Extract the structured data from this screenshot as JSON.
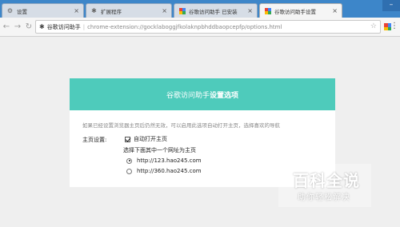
{
  "browser": {
    "tabs": [
      {
        "label": "设置",
        "icon": "gear-icon"
      },
      {
        "label": "扩展程序",
        "icon": "puzzle-icon"
      },
      {
        "label": "谷歌访问助手 已安装",
        "icon": "extension-color-icon"
      },
      {
        "label": "谷歌访问助手设置",
        "icon": "extension-color-icon",
        "active": true
      }
    ],
    "omnibox": {
      "origin": "谷歌访问助手",
      "url": "chrome-extension://gocklaboggjfkolaknpbhddbaopcepfp/options.html"
    }
  },
  "page": {
    "header_prefix": "谷歌访问助手",
    "header_bold": "设置选项",
    "intro": "如果已经设置浏览器主页后仍然无效，可以启用此选项自动打开主页，选择喜欢的导航",
    "homepage_label": "主页设置:",
    "auto_open_label": "自动打开主页",
    "choose_label": "选择下面其中一个网址为主页",
    "options": [
      {
        "label": "http://123.hao245.com",
        "selected": true
      },
      {
        "label": "http://360.hao245.com",
        "selected": false
      }
    ]
  },
  "watermark": {
    "title": "百科全说",
    "subtitle": "助你轻松解决"
  },
  "colors": {
    "header": "#4ecbbb",
    "tabstrip": "#3d86c9",
    "page_bg": "#efefef"
  }
}
